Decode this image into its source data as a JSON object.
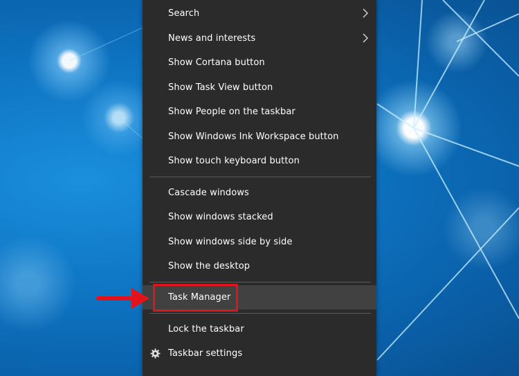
{
  "context_menu": {
    "items": [
      {
        "label": "Search",
        "has_submenu": true
      },
      {
        "label": "News and interests",
        "has_submenu": true
      },
      {
        "label": "Show Cortana button"
      },
      {
        "label": "Show Task View button"
      },
      {
        "label": "Show People on the taskbar"
      },
      {
        "label": "Show Windows Ink Workspace button"
      },
      {
        "label": "Show touch keyboard button"
      },
      {
        "label": "Cascade windows"
      },
      {
        "label": "Show windows stacked"
      },
      {
        "label": "Show windows side by side"
      },
      {
        "label": "Show the desktop"
      },
      {
        "label": "Task Manager",
        "highlighted": true
      },
      {
        "label": "Lock the taskbar"
      },
      {
        "label": "Taskbar settings",
        "icon": "gear-icon"
      }
    ]
  },
  "annotation": {
    "highlight_color": "#e3131b",
    "arrow_icon": "right-arrow-icon"
  },
  "colors": {
    "menu_background": "#2b2b2b",
    "menu_hover": "#414141",
    "separator": "#5b5b5b",
    "text": "#ffffff"
  }
}
